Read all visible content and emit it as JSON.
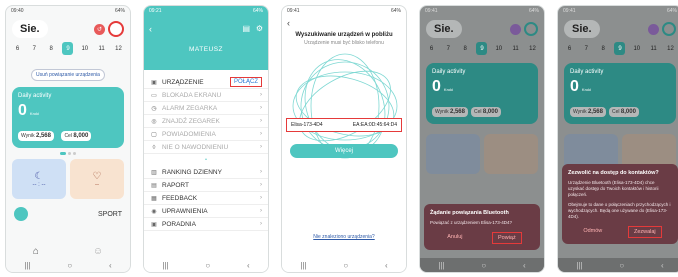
{
  "status_bar": {
    "time1": "09:40",
    "time2": "09:21",
    "time3": "09:41",
    "battery": "64%"
  },
  "days": [
    "6",
    "7",
    "8",
    "9",
    "10",
    "11",
    "12"
  ],
  "selected_day": "9",
  "screen1": {
    "greeting": "Sie.",
    "link_label": "Usuń powiązanie urządzenia",
    "activity_title": "Daily activity",
    "steps_value": "0",
    "steps_unit": "Kroki",
    "wynik_label": "Wynik",
    "wynik_value": "2,568",
    "cel_label": "Cel",
    "cel_value": "8,000",
    "tile_sleep": "-- : --",
    "tile_heart": "--",
    "sport_label": "SPORT",
    "badge": "↺"
  },
  "screen2": {
    "username": "MATEUSZ",
    "device_label": "URZĄDZENIE",
    "connect_label": "POŁĄCZ",
    "items": [
      "BLOKADA EKRANU",
      "ALARM ZEGARKA",
      "ZNAJDŹ ZEGAREK",
      "POWIADOMIENIA",
      "NIE O NAWODNIENIU"
    ],
    "items2": [
      "RANKING DZIENNY",
      "RAPORT",
      "FEEDBACK",
      "UPRAWNIENIA",
      "PORADNIA"
    ]
  },
  "screen3": {
    "title": "Wyszukiwanie urządzeń w pobliżu",
    "subtitle": "Urządzenie musi być blisko telefonu",
    "device_name": "Elisa-173-4D4",
    "device_mac": "EA:EA:0D:45:64:D4",
    "button": "Więcej",
    "not_found": "Nie znaleziono urządzenia?"
  },
  "screen4": {
    "dialog_title": "Żądanie powiązania Bluetooth",
    "dialog_text": "Powiązać z urządzeniem Elisa-173-4D4?",
    "cancel": "Anuluj",
    "ok": "Powiąż"
  },
  "screen5": {
    "dialog_title": "Zezwolić na dostęp do kontaktów?",
    "dialog_text": "Urządzenie Bluetooth (Elisa-173-4D4) chce uzyskać dostęp do Twoich kontaktów i historii połączeń.",
    "dialog_text2": "Obejmuje to dane o połączeniach przychodzących i wychodzących. Będą one używane do (Elisa-173-4D4).",
    "deny": "Odmów",
    "allow": "Zezwalaj"
  },
  "colors": {
    "accent": "#4ec6c0",
    "highlight": "#e53a3a",
    "dialog": "#6a3c45"
  }
}
